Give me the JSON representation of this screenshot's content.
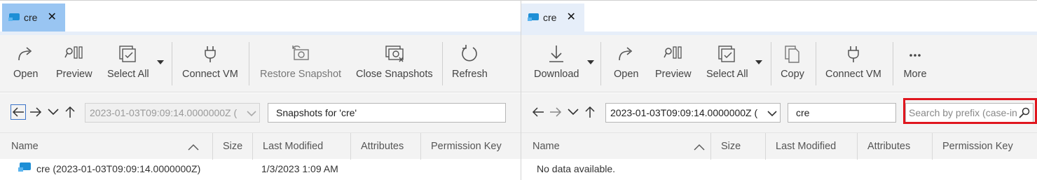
{
  "left": {
    "tab": {
      "label": "cre"
    },
    "toolbar": {
      "open": "Open",
      "preview": "Preview",
      "select_all": "Select All",
      "connect_vm": "Connect VM",
      "restore_snapshot": "Restore Snapshot",
      "close_snapshots": "Close Snapshots",
      "refresh": "Refresh"
    },
    "nav": {
      "snapshot_select": "2023-01-03T09:09:14.0000000Z (",
      "path": "Snapshots for 'cre'"
    },
    "columns": {
      "name": "Name",
      "size": "Size",
      "last_modified": "Last Modified",
      "attributes": "Attributes",
      "permission_key": "Permission Key"
    },
    "rows": [
      {
        "name": "cre (2023-01-03T09:09:14.0000000Z)",
        "size": "",
        "last_modified": "1/3/2023 1:09 AM"
      }
    ]
  },
  "right": {
    "tab": {
      "label": "cre"
    },
    "toolbar": {
      "download": "Download",
      "open": "Open",
      "preview": "Preview",
      "select_all": "Select All",
      "copy": "Copy",
      "connect_vm": "Connect VM",
      "more": "More"
    },
    "nav": {
      "snapshot_select": "2023-01-03T09:09:14.0000000Z (",
      "path": "cre",
      "search_placeholder": "Search by prefix (case-in"
    },
    "columns": {
      "name": "Name",
      "size": "Size",
      "last_modified": "Last Modified",
      "attributes": "Attributes",
      "permission_key": "Permission Key"
    },
    "empty_text": "No data available."
  },
  "colors": {
    "active_tab": "#99c5f2",
    "inactive_tab": "#e6eef9",
    "highlight": "#e0161e",
    "share_icon": "#1e8fd6"
  }
}
